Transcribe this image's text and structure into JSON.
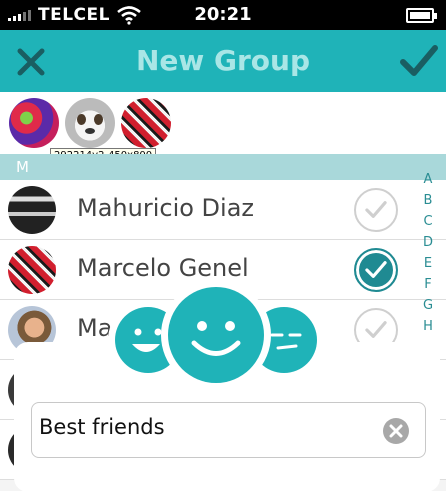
{
  "status_bar": {
    "carrier": "TELCEL",
    "time": "20:21"
  },
  "header": {
    "title": "New Group",
    "close_icon": "close-x-icon",
    "done_icon": "checkmark-icon"
  },
  "selected_strip": {
    "tooltip": "292214v2-450x800"
  },
  "section": {
    "letter": "M"
  },
  "contacts": [
    {
      "name": "Mahuricio Diaz",
      "checked": false
    },
    {
      "name": "Marcelo Genel",
      "checked": true
    },
    {
      "name": "Ma",
      "checked": false
    },
    {
      "name": "",
      "checked": false
    },
    {
      "name": "",
      "checked": false
    }
  ],
  "index_letters": [
    "A",
    "B",
    "C",
    "D",
    "E",
    "F",
    "G",
    "H"
  ],
  "dialog": {
    "group_name_value": "Best friends",
    "clear_icon": "clear-x-icon",
    "faces_icon": "smiley-faces-icon"
  },
  "colors": {
    "accent": "#1fb3b8",
    "accent_dark": "#1f8a92",
    "section": "#a9d8da"
  }
}
